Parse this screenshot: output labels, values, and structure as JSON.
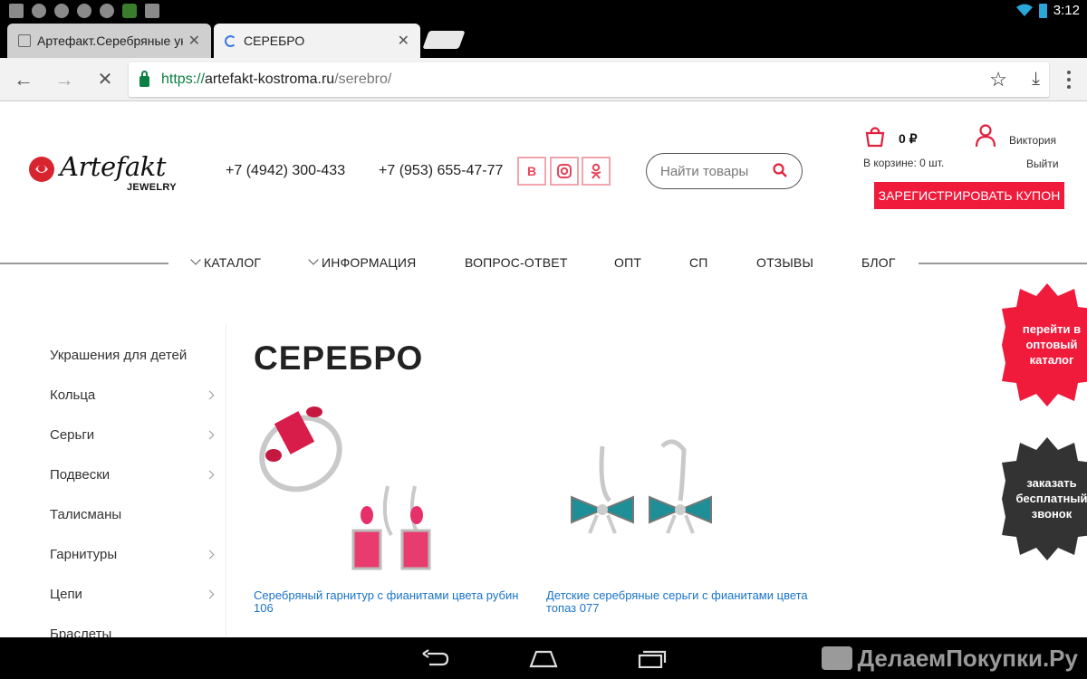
{
  "statusbar": {
    "time": "3:12"
  },
  "tabs": [
    {
      "title": "Артефакт.Серебряные украшения",
      "active": false
    },
    {
      "title": "СЕРЕБРО",
      "active": true
    }
  ],
  "toolbar": {
    "url_scheme": "https://",
    "url_host": "artefakt-kostroma.ru",
    "url_path": "/serebro/"
  },
  "header": {
    "logo_text": "Artefakt",
    "logo_sub": "JEWELRY",
    "phone1": "+7 (4942) 300-433",
    "phone2": "+7 (953) 655-47-77",
    "social": [
      "в",
      "ig",
      "ок"
    ],
    "search_placeholder": "Найти товары",
    "cart_sum": "0 ₽",
    "cart_info": "В корзине: 0 шт.",
    "user_name": "Виктория",
    "logout": "Выйти",
    "coupon_button": "ЗАРЕГИСТРИРОВАТЬ КУПОН",
    "accent_color": "#f01a3b"
  },
  "nav": {
    "items": [
      {
        "label": "КАТАЛОГ",
        "dropdown": true
      },
      {
        "label": "ИНФОРМАЦИЯ",
        "dropdown": true
      },
      {
        "label": "ВОПРОС-ОТВЕТ",
        "dropdown": false
      },
      {
        "label": "ОПТ",
        "dropdown": false
      },
      {
        "label": "СП",
        "dropdown": false
      },
      {
        "label": "ОТЗЫВЫ",
        "dropdown": false
      },
      {
        "label": "БЛОГ",
        "dropdown": false
      }
    ]
  },
  "sidebar": {
    "items": [
      {
        "label": "Украшения для детей",
        "arrow": false
      },
      {
        "label": "Кольца",
        "arrow": true
      },
      {
        "label": "Серьги",
        "arrow": true
      },
      {
        "label": "Подвески",
        "arrow": true
      },
      {
        "label": "Талисманы",
        "arrow": false
      },
      {
        "label": "Гарнитуры",
        "arrow": true
      },
      {
        "label": "Цепи",
        "arrow": true
      },
      {
        "label": "Браслеты",
        "arrow": false
      }
    ]
  },
  "main": {
    "title": "СЕРЕБРО",
    "products": [
      {
        "name": "Серебряный гарнитур с фианитами цвета рубин 106",
        "image": "ruby-set"
      },
      {
        "name": "Детские серебряные серьги с фианитами цвета топаз 077",
        "image": "topaz-bow-earrings"
      }
    ]
  },
  "badges": {
    "wholesale": "перейти в оптовый каталог",
    "callback": "заказать бесплатный звонок"
  },
  "watermark": "ДелаемПокупки.Ру"
}
